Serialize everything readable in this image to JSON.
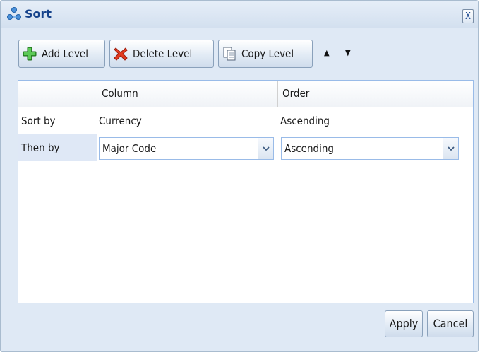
{
  "dialog": {
    "title": "Sort",
    "close_label": "X"
  },
  "toolbar": {
    "add_label": "Add Level",
    "delete_label": "Delete Level",
    "copy_label": "Copy Level",
    "move_up_glyph": "▲",
    "move_down_glyph": "▼"
  },
  "grid": {
    "headers": [
      "",
      "Column",
      "Order"
    ],
    "rows": [
      {
        "label": "Sort by",
        "column": "Currency",
        "order": "Ascending"
      },
      {
        "label": "Then by",
        "column": "Major Code",
        "order": "Ascending"
      }
    ]
  },
  "footer": {
    "apply_label": "Apply",
    "cancel_label": "Cancel"
  },
  "colors": {
    "accent": "#15428b",
    "dialog_bg": "#dfe9f5",
    "grid_border": "#99bbe8",
    "selected_label_bg": "#dfe8f6"
  },
  "icons": {
    "title": "sort-icon",
    "add": "plus-icon",
    "delete": "delete-x-icon",
    "copy": "copy-icon"
  }
}
